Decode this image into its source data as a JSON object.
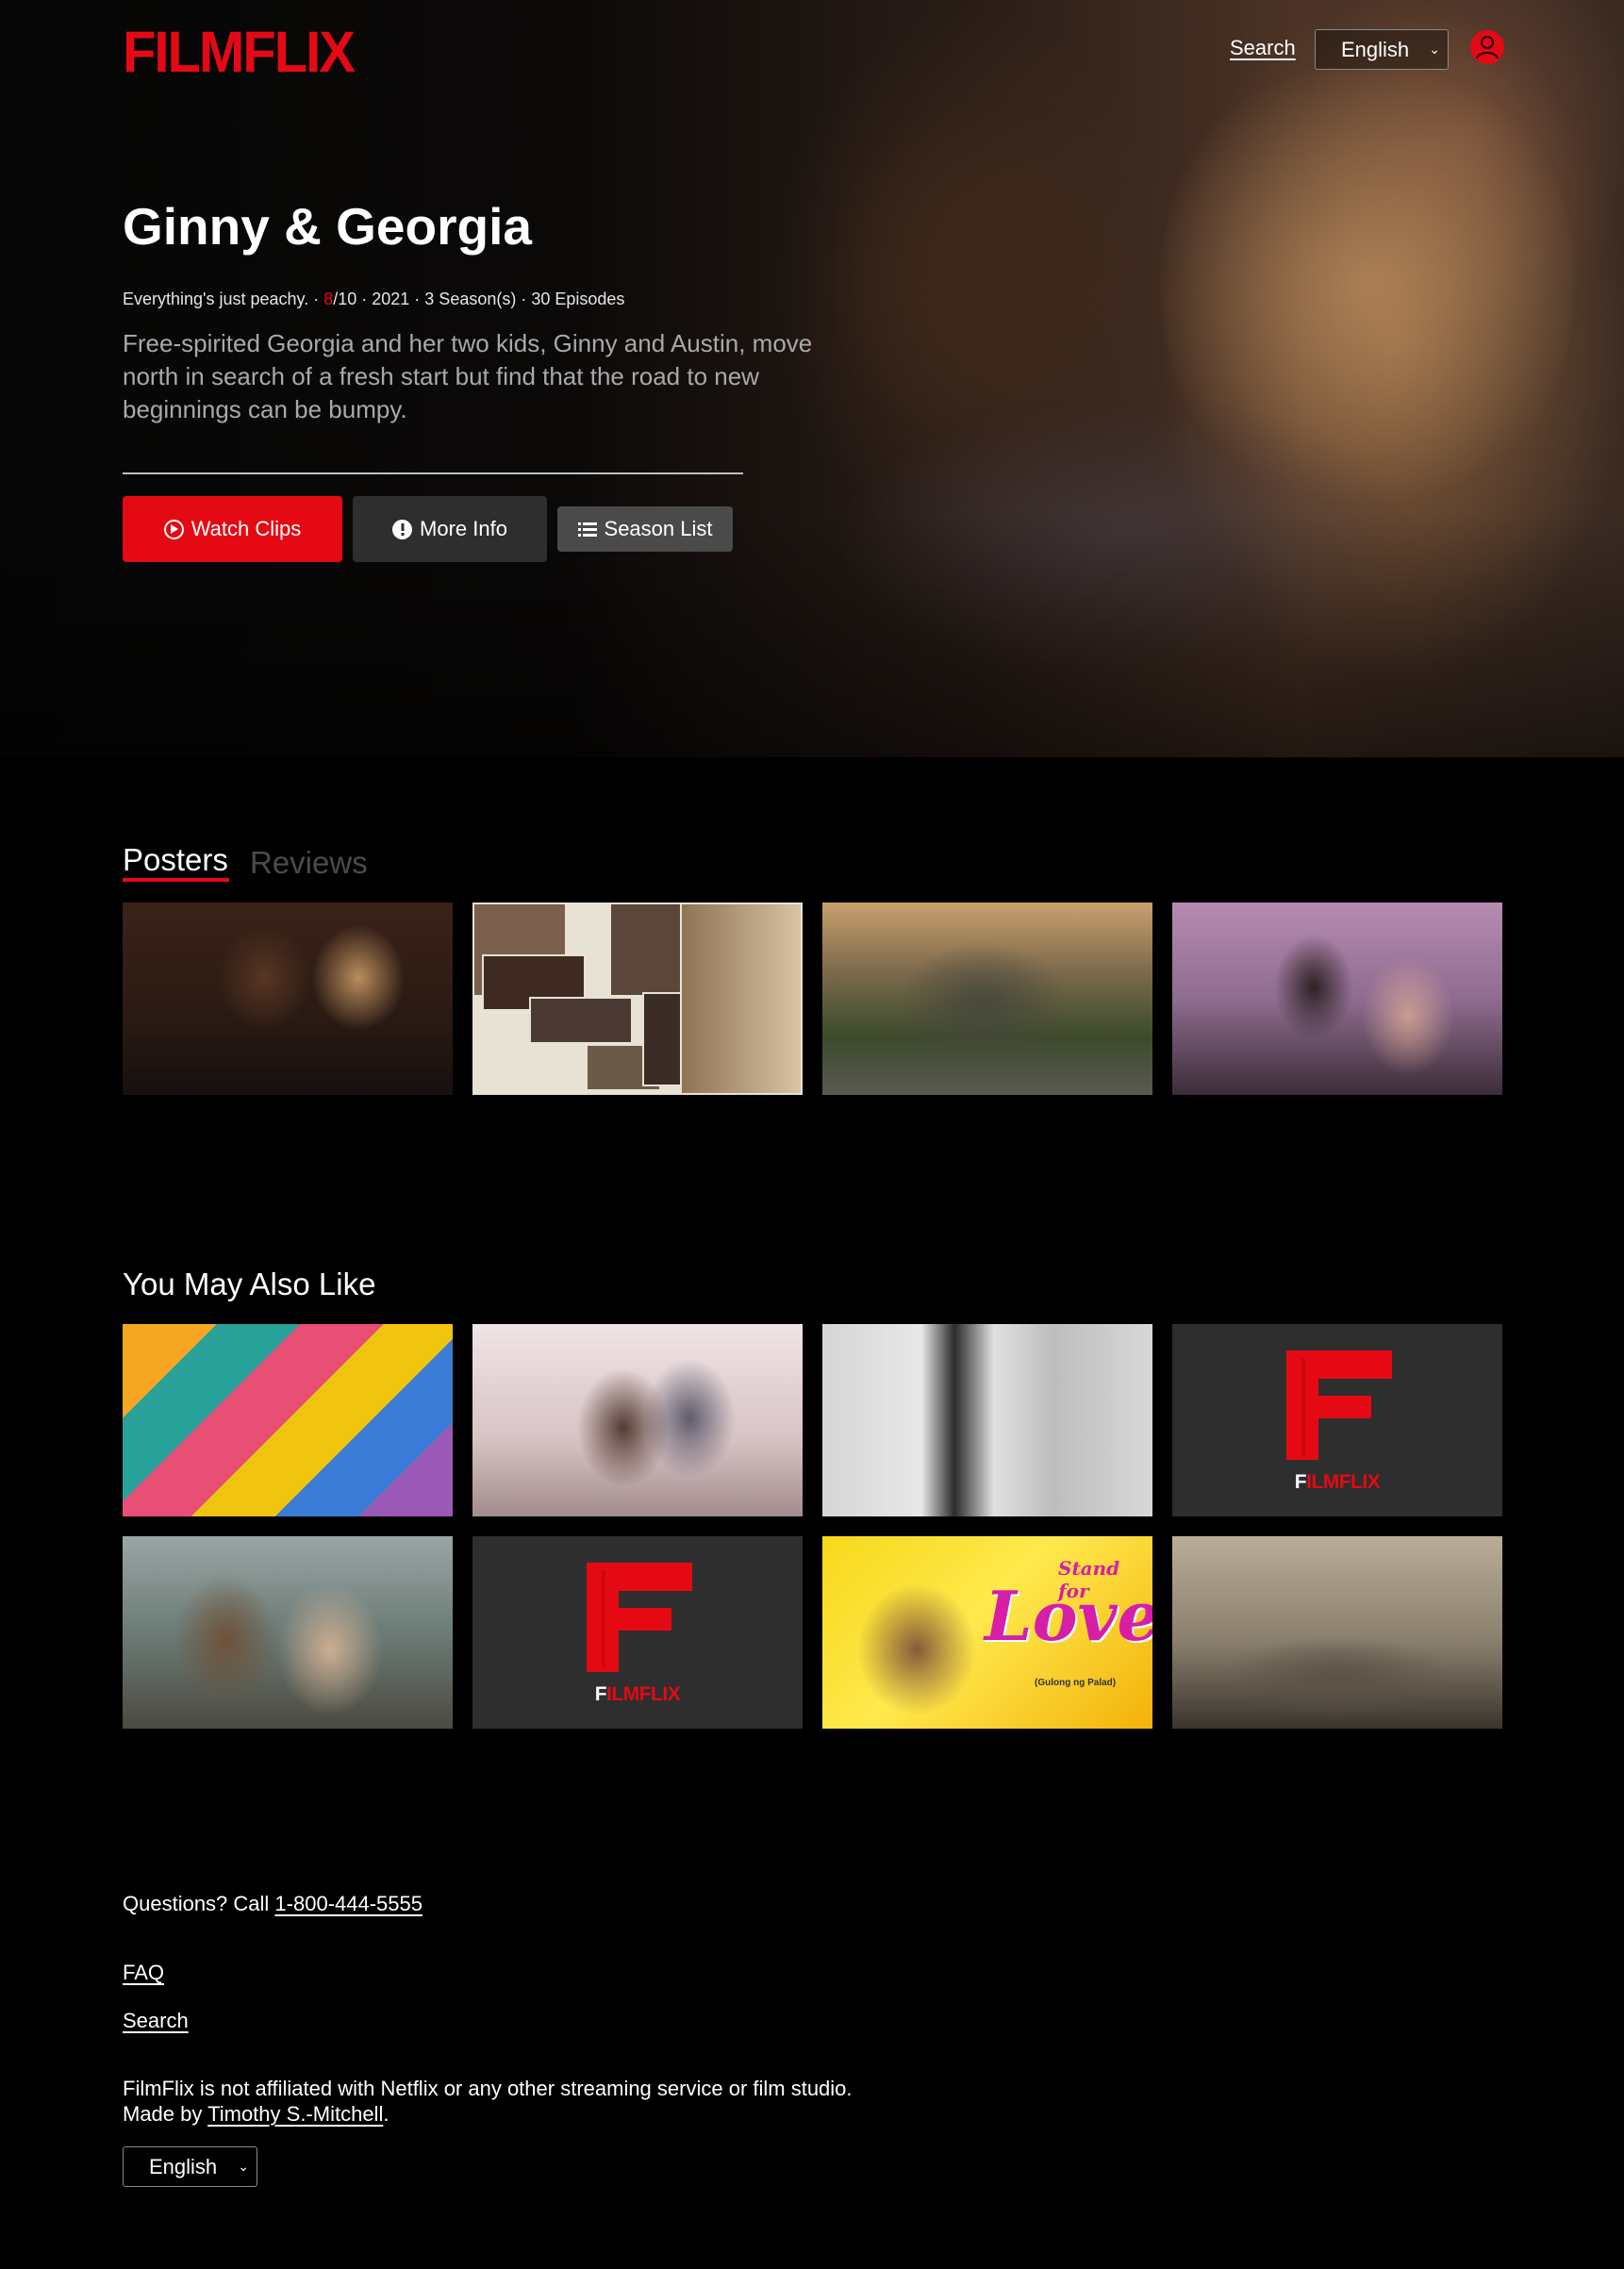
{
  "brand": {
    "name": "FILMFLIX",
    "accent": "#e50914"
  },
  "header": {
    "search_label": "Search",
    "language_selected": "English",
    "avatar_icon": "user-avatar-icon"
  },
  "hero": {
    "title": "Ginny & Georgia",
    "tagline": "Everything's just peachy.",
    "rating_value": "8",
    "rating_max": "/10",
    "year": "2021",
    "seasons": "3 Season(s)",
    "episodes": "30 Episodes",
    "sep": " · ",
    "description": "Free-spirited Georgia and her two kids, Ginny and Austin, move north in search of a fresh start but find that the road to new beginnings can be bumpy.",
    "buttons": {
      "watch": "Watch Clips",
      "more": "More Info",
      "season": "Season List"
    }
  },
  "tabs": {
    "posters": "Posters",
    "reviews": "Reviews",
    "active": "Posters"
  },
  "recommendations": {
    "title": "You May Also Like",
    "placeholder_logo_text": "FILMFLIX",
    "stand_text": "Stand for",
    "love_text": "Love",
    "love_sub": "(Gulong ng Palad)"
  },
  "footer": {
    "questions_prefix": "Questions? Call ",
    "phone": "1-800-444-5555",
    "faq": "FAQ",
    "search": "Search",
    "disclaimer": "FilmFlix is not affiliated with Netflix or any other streaming service or film studio.",
    "made_by_prefix": "Made by ",
    "author": "Timothy S.-Mitchell",
    "made_by_suffix": ".",
    "language_selected": "English"
  }
}
